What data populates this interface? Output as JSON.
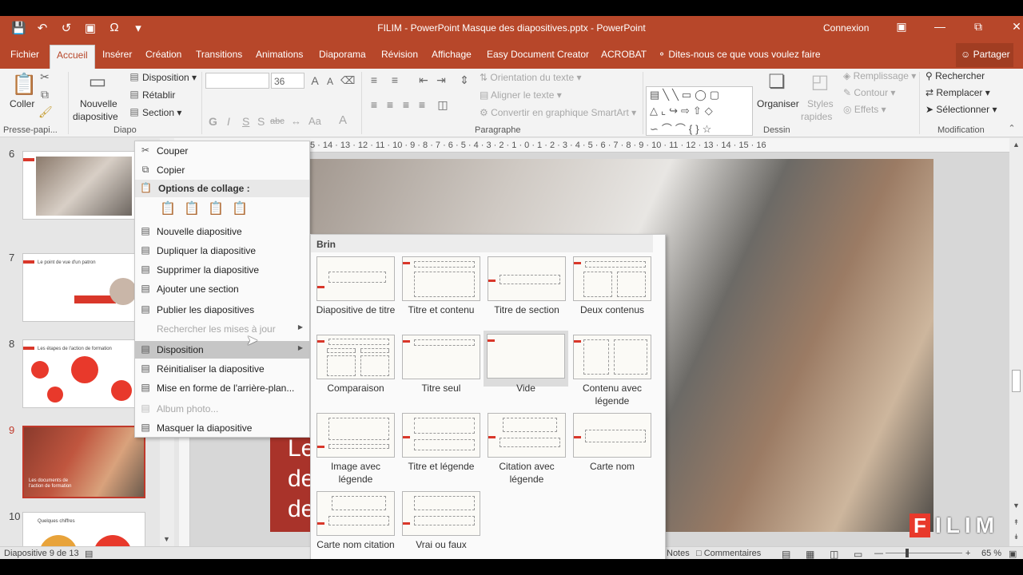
{
  "titlebar": {
    "title": "FILIM - PowerPoint Masque des diapositives.pptx - PowerPoint",
    "connexion": "Connexion",
    "qat_icons": [
      "save-icon",
      "undo-icon",
      "redo-icon",
      "touch-icon",
      "omega-icon",
      "customize-icon"
    ]
  },
  "tabs": [
    "Fichier",
    "Accueil",
    "Insérer",
    "Création",
    "Transitions",
    "Animations",
    "Diaporama",
    "Révision",
    "Affichage",
    "Easy Document Creator",
    "ACROBAT"
  ],
  "tellme": "Dites-nous ce que vous voulez faire",
  "partager": "Partager",
  "ribbon": {
    "coller": "Coller",
    "presse_papiers": "Presse-papi...",
    "nouvelle": "Nouvelle",
    "diapositive": "diapositive",
    "diapo_group": "Diapo",
    "disposition": "Disposition",
    "retablir": "Rétablir",
    "section": "Section",
    "font_size": "36",
    "orientation": "Orientation du texte",
    "aligner": "Aligner le texte",
    "convertir": "Convertir en graphique SmartArt",
    "paragraphe": "Paragraphe",
    "organiser": "Organiser",
    "styles1": "Styles",
    "styles2": "rapides",
    "remplissage": "Remplissage",
    "contour": "Contour",
    "effets": "Effets",
    "dessin": "Dessin",
    "rechercher": "Rechercher",
    "remplacer": "Remplacer",
    "selectionner": "Sélectionner",
    "modification": "Modification",
    "font_buttons": [
      "G",
      "I",
      "S",
      "S",
      "abc",
      "Aa",
      "A"
    ]
  },
  "ruler": "5 · 14 · 13 · 12 · 11 · 10 · 9 · 8 · 7 · 6 · 5 · 4 · 3 · 2 · 1 · 0 · 1 · 2 · 3 · 4 · 5 · 6 · 7 · 8 · 9 · 10 · 11 · 12 · 13 · 14 · 15 · 16",
  "thumbnails": [
    {
      "num": "6",
      "title": ""
    },
    {
      "num": "7",
      "title": "Le point de vue d'un patron"
    },
    {
      "num": "8",
      "title": "Les étapes de l'action de formation"
    },
    {
      "num": "9",
      "title": "Les documents de l'action de formation"
    },
    {
      "num": "10",
      "title": "Quelques chiffres"
    }
  ],
  "slide": {
    "text1": "Le",
    "text2": "de",
    "text3": "de"
  },
  "context_menu": {
    "couper": "Couper",
    "copier": "Copier",
    "options_collage": "Options de collage :",
    "nouvelle": "Nouvelle diapositive",
    "dupliquer": "Dupliquer la diapositive",
    "supprimer": "Supprimer la diapositive",
    "ajouter_section": "Ajouter une section",
    "publier": "Publier les diapositives",
    "rechercher_maj": "Rechercher les mises à jour",
    "disposition": "Disposition",
    "reinitialiser": "Réinitialiser la diapositive",
    "mise_en_forme": "Mise en forme de l'arrière-plan...",
    "album": "Album photo...",
    "masquer": "Masquer la diapositive"
  },
  "gallery": {
    "header": "Brin",
    "layouts": [
      "Diapositive de titre",
      "Titre et contenu",
      "Titre de section",
      "Deux contenus",
      "Comparaison",
      "Titre seul",
      "Vide",
      "Contenu avec légende",
      "Image avec légende",
      "Titre et légende",
      "Citation avec légende",
      "Carte nom",
      "Carte nom citation",
      "Vrai ou faux"
    ],
    "selected": "Vide"
  },
  "status": {
    "slide_count": "Diapositive 9 de 13",
    "notes": "Notes",
    "comments": "Commentaires",
    "zoom": "65 %"
  },
  "watermark": {
    "letter": "F",
    "rest": "ILIM"
  },
  "colors": {
    "brand": "#b7472a",
    "accent_red": "#e8392b"
  }
}
